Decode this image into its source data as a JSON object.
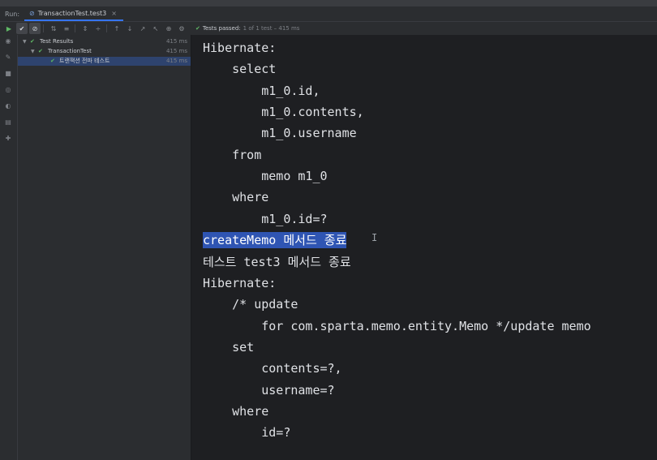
{
  "tab_bar": {
    "run_label": "Run:",
    "tab_title": "TransactionTest.test3",
    "tab_close": "×"
  },
  "toolbar": {
    "status_check": "✔",
    "status_text": "Tests passed:",
    "status_count": "1 of 1 test – 415 ms"
  },
  "tree": {
    "rows": [
      {
        "name": "Test Results",
        "time": "415 ms"
      },
      {
        "name": "TransactionTest",
        "time": "415 ms"
      },
      {
        "name": "트랜잭션 전파 테스트",
        "time": "415 ms"
      }
    ]
  },
  "console": {
    "lines": [
      "Hibernate:",
      "    select",
      "        m1_0.id,",
      "        m1_0.contents,",
      "        m1_0.username",
      "    from",
      "        memo m1_0",
      "    where",
      "        m1_0.id=?",
      "createMemo 메서드 종료",
      "테스트 test3 메서드 종료",
      "Hibernate:",
      "    /* update",
      "        for com.sparta.memo.entity.Memo */update memo",
      "    set",
      "        contents=?,",
      "        username=?",
      "    where",
      "        id=?"
    ]
  }
}
